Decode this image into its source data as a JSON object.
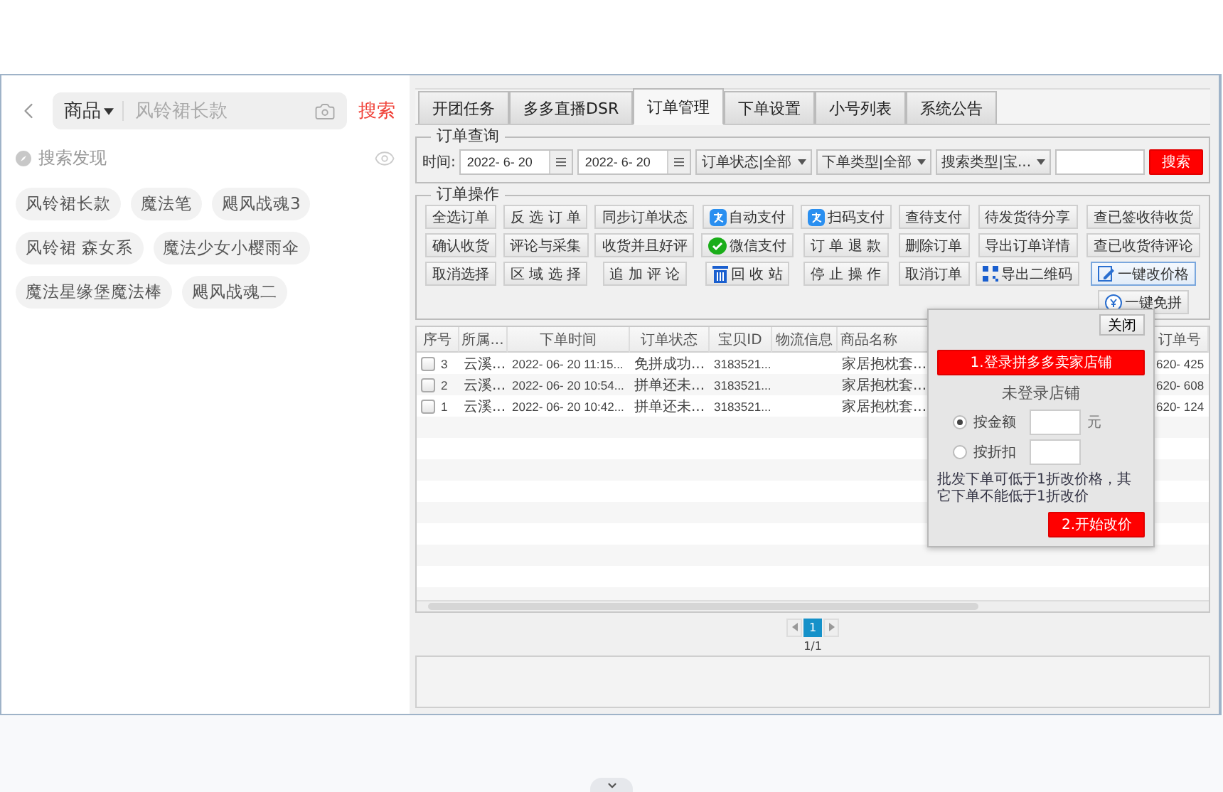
{
  "search_panel": {
    "category": "商品",
    "placeholder": "风铃裙长款",
    "search_button": "搜索",
    "discover_title": "搜索发现",
    "tags": [
      "风铃裙长款",
      "魔法笔",
      "飓风战魂3",
      "风铃裙 森女系",
      "魔法少女小樱雨伞",
      "魔法星缘堡魔法棒",
      "飓风战魂二"
    ]
  },
  "tabs": [
    {
      "label": "开团任务",
      "selected": false
    },
    {
      "label": "多多直播DSR",
      "selected": false
    },
    {
      "label": "订单管理",
      "selected": true
    },
    {
      "label": "下单设置",
      "selected": false
    },
    {
      "label": "小号列表",
      "selected": false
    },
    {
      "label": "系统公告",
      "selected": false
    }
  ],
  "order_query": {
    "title": "订单查询",
    "time_label": "时间:",
    "start_date": "2022- 6- 20",
    "end_date": "2022- 6- 20",
    "filters": [
      "订单状态|全部",
      "下单类型|全部",
      "搜索类型|宝..."
    ],
    "search_button": "搜索"
  },
  "order_actions": {
    "title": "订单操作",
    "buttons": [
      {
        "label": "全选订单",
        "kind": "plain",
        "highlighted": false
      },
      {
        "label": "反 选 订 单",
        "kind": "plain",
        "highlighted": false
      },
      {
        "label": "同步订单状态",
        "kind": "plain",
        "highlighted": false
      },
      {
        "label": "自动支付",
        "kind": "alipay",
        "highlighted": false
      },
      {
        "label": "扫码支付",
        "kind": "alipay",
        "highlighted": false
      },
      {
        "label": "查待支付",
        "kind": "plain",
        "highlighted": false
      },
      {
        "label": "待发货待分享",
        "kind": "plain",
        "highlighted": false
      },
      {
        "label": "查已签收待收货",
        "kind": "plain",
        "highlighted": false
      },
      {
        "label": "确认收货",
        "kind": "plain",
        "highlighted": false
      },
      {
        "label": "评论与采集",
        "kind": "plain",
        "highlighted": false
      },
      {
        "label": "收货并且好评",
        "kind": "plain",
        "highlighted": false
      },
      {
        "label": "微信支付",
        "kind": "wechat",
        "highlighted": false
      },
      {
        "label": "订 单 退 款",
        "kind": "plain",
        "highlighted": false
      },
      {
        "label": "删除订单",
        "kind": "plain",
        "highlighted": false
      },
      {
        "label": "导出订单详情",
        "kind": "plain",
        "highlighted": false
      },
      {
        "label": "查已收货待评论",
        "kind": "plain",
        "highlighted": false
      },
      {
        "label": "取消选择",
        "kind": "plain",
        "highlighted": false
      },
      {
        "label": "区 域 选 择",
        "kind": "plain",
        "highlighted": false
      },
      {
        "label": "追 加 评 论",
        "kind": "plain",
        "highlighted": false
      },
      {
        "label": "回 收 站",
        "kind": "trash",
        "highlighted": false
      },
      {
        "label": "停 止 操 作",
        "kind": "plain",
        "highlighted": false
      },
      {
        "label": "取消订单",
        "kind": "plain",
        "highlighted": false
      },
      {
        "label": "导出二维码",
        "kind": "qrcode",
        "highlighted": false
      },
      {
        "label": "一键改价格",
        "kind": "edit",
        "highlighted": true
      },
      {
        "label": "一键免拼",
        "kind": "coin",
        "highlighted": false
      }
    ]
  },
  "table": {
    "columns": [
      "序号",
      "所属...",
      "下单时间",
      "订单状态",
      "宝贝ID",
      "物流信息",
      "商品名称",
      "订单号"
    ],
    "rows": [
      {
        "checked": false,
        "cells": [
          "3",
          "云溪...",
          "2022- 06- 20 11:15...",
          "免拼成功...",
          "3183521...",
          null,
          "家居抱枕套...",
          "620- 425"
        ]
      },
      {
        "checked": false,
        "cells": [
          "2",
          "云溪...",
          "2022- 06- 20 10:54...",
          "拼单还未...",
          "3183521...",
          null,
          "家居抱枕套...",
          "620- 608"
        ]
      },
      {
        "checked": false,
        "cells": [
          "1",
          "云溪...",
          "2022- 06- 20 10:42...",
          "拼单还未...",
          "3183521...",
          null,
          "家居抱枕套...",
          "620- 124"
        ]
      }
    ]
  },
  "pagination": {
    "pages": [
      {
        "label": "1",
        "selected": true
      }
    ],
    "summary": "1/1"
  },
  "dialog": {
    "close_button": "关闭",
    "login_button": "1.登录拼多多卖家店铺",
    "status": "未登录店铺",
    "modes": [
      {
        "label": "按金额",
        "selected": true,
        "unit": "元"
      },
      {
        "label": "按折扣",
        "selected": false
      }
    ],
    "note": "批发下单可低于1折改价格，其它下单不能低于1折改价",
    "start_button": "2.开始改价"
  }
}
